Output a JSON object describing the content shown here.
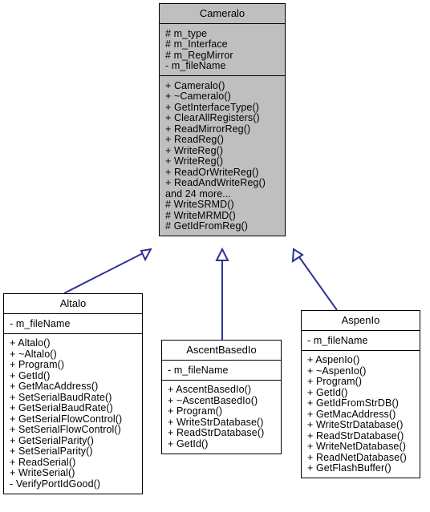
{
  "diagram": {
    "type": "uml-class-diagram",
    "title": "Cameralo inheritance diagram",
    "fill_color": "#bfbfbf",
    "border_color": "#000000",
    "connector_color": "#2e3192",
    "background": "#ffffff"
  },
  "classes": {
    "cameralo": {
      "name": "Cameralo",
      "attributes": [
        "# m_type",
        "# m_Interface",
        "# m_RegMirror",
        "- m_fileName"
      ],
      "operations": [
        "+ Cameralo()",
        "+ ~Cameralo()",
        "+ GetInterfaceType()",
        "+ ClearAllRegisters()",
        "+ ReadMirrorReg()",
        "+ ReadReg()",
        "+ WriteReg()",
        "+ WriteReg()",
        "+ ReadOrWriteReg()",
        "+ ReadAndWriteReg()",
        "and 24 more...",
        "# WriteSRMD()",
        "# WriteMRMD()",
        "# GetIdFromReg()"
      ]
    },
    "altalo": {
      "name": "Altalo",
      "attributes": [
        "- m_fileName"
      ],
      "operations": [
        "+ Altalo()",
        "+ ~Altalo()",
        "+ Program()",
        "+ GetId()",
        "+ GetMacAddress()",
        "+ SetSerialBaudRate()",
        "+ GetSerialBaudRate()",
        "+ GetSerialFlowControl()",
        "+ SetSerialFlowControl()",
        "+ GetSerialParity()",
        "+ SetSerialParity()",
        "+ ReadSerial()",
        "+ WriteSerial()",
        "- VerifyPortIdGood()"
      ]
    },
    "ascentbasedio": {
      "name": "AscentBasedIo",
      "attributes": [
        "- m_fileName"
      ],
      "operations": [
        "+ AscentBasedIo()",
        "+ ~AscentBasedIo()",
        "+ Program()",
        "+ WriteStrDatabase()",
        "+ ReadStrDatabase()",
        "+ GetId()"
      ]
    },
    "aspenio": {
      "name": "AspenIo",
      "attributes": [
        "- m_fileName"
      ],
      "operations": [
        "+ AspenIo()",
        "+ ~AspenIo()",
        "+ Program()",
        "+ GetId()",
        "+ GetIdFromStrDB()",
        "+ GetMacAddress()",
        "+ WriteStrDatabase()",
        "+ ReadStrDatabase()",
        "+ WriteNetDatabase()",
        "+ ReadNetDatabase()",
        "+ GetFlashBuffer()"
      ]
    }
  },
  "relationships": [
    {
      "from": "altalo",
      "to": "cameralo",
      "kind": "generalization"
    },
    {
      "from": "ascentbasedio",
      "to": "cameralo",
      "kind": "generalization"
    },
    {
      "from": "aspenio",
      "to": "cameralo",
      "kind": "generalization"
    }
  ]
}
